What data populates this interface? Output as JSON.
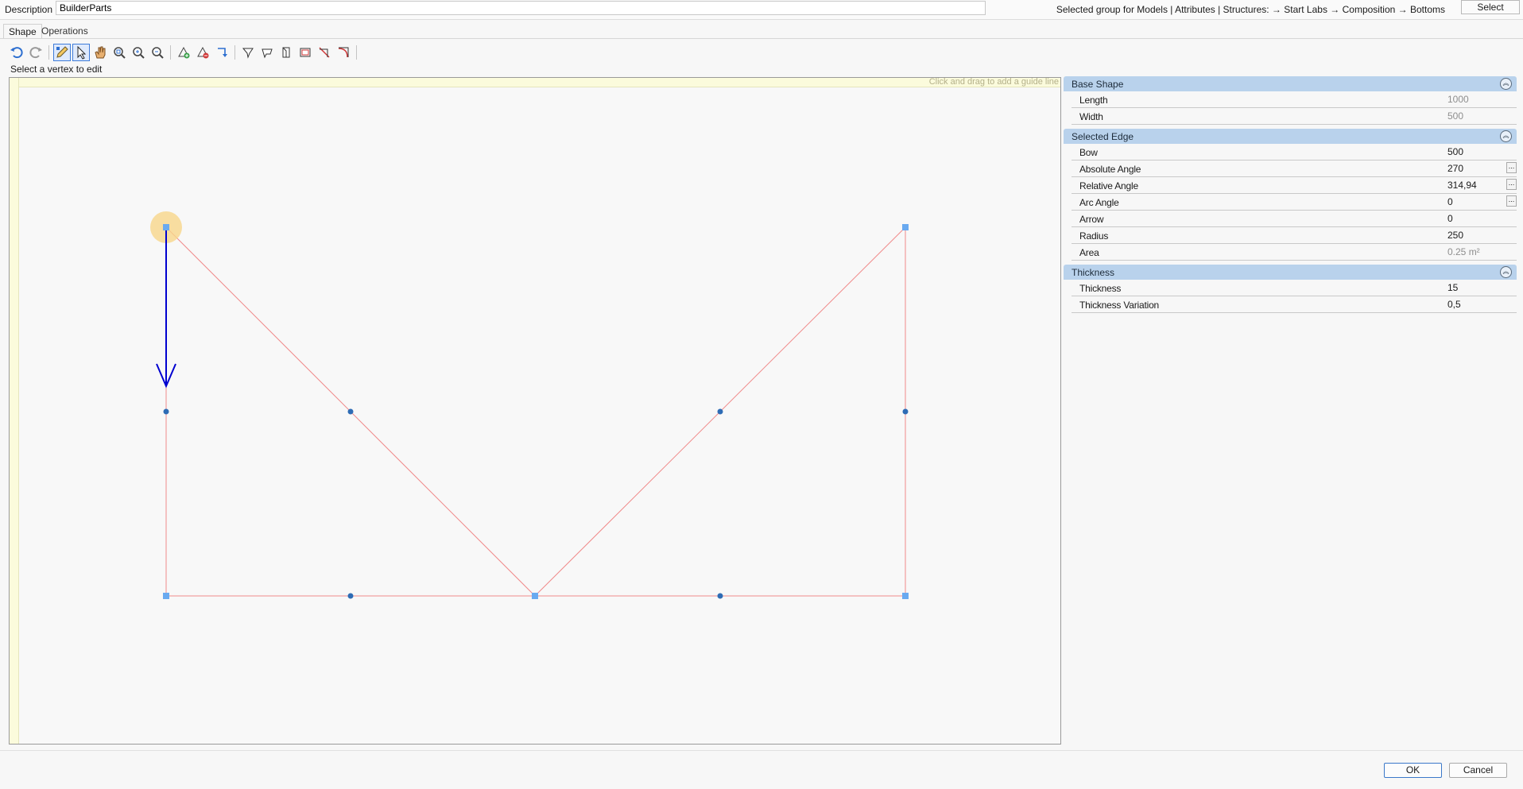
{
  "header": {
    "description_label": "Description",
    "description_value": "BuilderParts",
    "group_path": "Selected group for Models | Attributes | Structures:  → Start Labs → Composition → Bottoms",
    "select_label": "Select"
  },
  "tabs": [
    {
      "label": "Shape",
      "active": true
    },
    {
      "label": "Operations",
      "active": false
    }
  ],
  "toolbar": {
    "icons": [
      "undo-icon",
      "redo-icon",
      "edit-vertex-icon",
      "select-arrow-icon",
      "pan-hand-icon",
      "zoom-fit-icon",
      "zoom-in-icon",
      "zoom-out-icon",
      "add-vertex-icon",
      "remove-vertex-icon",
      "rotate-icon",
      "shape-a-icon",
      "shape-b-icon",
      "shape-c-icon",
      "shape-d-icon",
      "cut-line-icon",
      "cut-arc-icon"
    ]
  },
  "hint": "Select a vertex to edit",
  "canvas": {
    "guide_hint": "Click and drag to add a guide line",
    "shape_color": "#f08a8a",
    "vertex_color": "#6aaaf0",
    "selection_color": "#0000d0"
  },
  "properties": {
    "base_shape": {
      "title": "Base Shape",
      "rows": [
        {
          "key": "Length",
          "value": "1000"
        },
        {
          "key": "Width",
          "value": "500"
        }
      ]
    },
    "selected_edge": {
      "title": "Selected Edge",
      "rows": [
        {
          "key": "Bow",
          "value": "500"
        },
        {
          "key": "Absolute Angle",
          "value": "270"
        },
        {
          "key": "Relative Angle",
          "value": "314,94"
        },
        {
          "key": "Arc Angle",
          "value": "0"
        },
        {
          "key": "Arrow",
          "value": "0"
        },
        {
          "key": "Radius",
          "value": "250"
        },
        {
          "key": "Area",
          "value": "0.25 m²"
        }
      ],
      "ellipsis": "..."
    },
    "thickness": {
      "title": "Thickness",
      "rows": [
        {
          "key": "Thickness",
          "value": "15"
        },
        {
          "key": "Thickness Variation",
          "value": "0,5"
        }
      ]
    }
  },
  "footer": {
    "ok_label": "OK",
    "cancel_label": "Cancel"
  }
}
